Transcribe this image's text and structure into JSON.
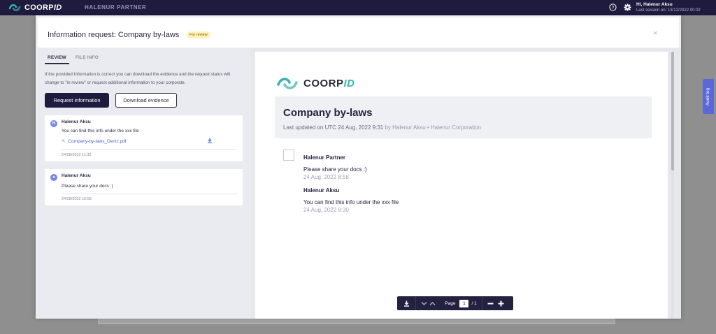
{
  "app": {
    "logo_main": "COORP",
    "logo_accent": "ID",
    "tenant": "HALENUR PARTNER",
    "user_greeting": "Hi, Halenur Aksu",
    "last_session": "Last session on: 13/12/2022 00:02",
    "help_icon": "help-circle-icon",
    "settings_icon": "gear-icon"
  },
  "audit_tab": {
    "label": "Audit log"
  },
  "modal": {
    "title": "Information request: Company by-laws",
    "status_badge": "For review",
    "close_label": "×"
  },
  "left_panel": {
    "tabs": [
      {
        "label": "REVIEW",
        "active": true
      },
      {
        "label": "FILE INFO",
        "active": false
      }
    ],
    "description": "If the provided Information is correct you can download the evidence and the request status will change to \"in review\" or request additional information to your corporate.",
    "request_button": "Request information",
    "download_button": "Download evidence",
    "messages": [
      {
        "author": "Halenur Aksu",
        "text": "You can find this info under the xxx file",
        "file": "Company-by-laws_Deniz.pdf",
        "date": "24/08/2022 11:30"
      },
      {
        "author": "Halenur Aksu",
        "text": "Please share your docs :)",
        "date": "24/08/2022 10:58"
      }
    ]
  },
  "document": {
    "logo_main": "COORP",
    "logo_accent": "ID",
    "title": "Company by-laws",
    "updated": "Last updated on UTC 24 Aug, 2022 9:31",
    "by": " by Halenur Aksu • Halenur Corporation",
    "entries": [
      {
        "name": "Halenur Partner",
        "message": "Please share your docs :)",
        "date": "24 Aug, 2022 8:58"
      },
      {
        "name": "Halenur Aksu",
        "message": "You can find this info under the xxx file",
        "date": "24 Aug, 2022 9:30"
      }
    ]
  },
  "pdf_toolbar": {
    "page_label": "Page",
    "current_page": "1",
    "total_pages": "/ 1"
  }
}
